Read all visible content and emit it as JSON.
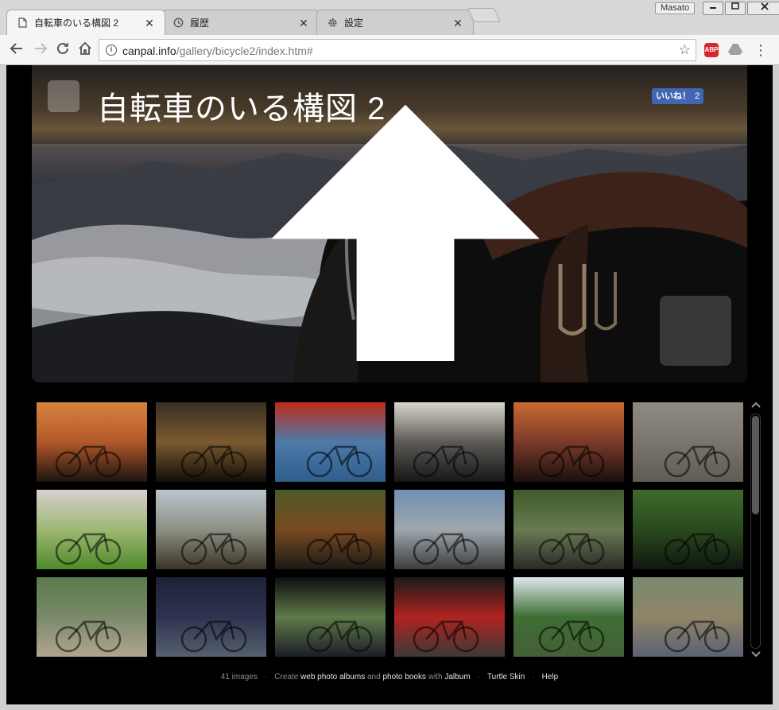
{
  "window": {
    "profile": "Masato",
    "tabs": [
      {
        "label": "自転車のいる構図 2",
        "icon": "page-icon",
        "active": true
      },
      {
        "label": "履歴",
        "icon": "history-icon",
        "active": false
      },
      {
        "label": "設定",
        "icon": "gear-icon",
        "active": false
      }
    ],
    "close_glyph": "✕"
  },
  "toolbar": {
    "url_host": "canpal.info",
    "url_path": "/gallery/bicycle2/index.htm#",
    "ext_label": "ABP"
  },
  "gallery": {
    "title": "自転車のいる構図 2",
    "like_label": "いいね！",
    "like_count": "2"
  },
  "thumbnails": [
    {
      "name": "sunset-sea-bikes",
      "top": "#d8833f",
      "mid": "#b2582a",
      "bottom": "#1a1410"
    },
    {
      "name": "golden-sea-bikes",
      "top": "#3a2e22",
      "mid": "#7a5a2f",
      "bottom": "#120e0a"
    },
    {
      "name": "handlebar-closeup",
      "top": "#c02a1a",
      "mid": "#4d7aa8",
      "bottom": "#2f5d8d"
    },
    {
      "name": "cloud-sea-handlebar",
      "top": "#d9d6cd",
      "mid": "#5d5a55",
      "bottom": "#16161a"
    },
    {
      "name": "sunset-handlebar",
      "top": "#c86a2f",
      "mid": "#7b3a2a",
      "bottom": "#1a100e"
    },
    {
      "name": "gravel-blue-bike",
      "top": "#8f8a82",
      "mid": "#7a766e",
      "bottom": "#5f5b55"
    },
    {
      "name": "sakura-meadow",
      "top": "#d8cfd0",
      "mid": "#9db872",
      "bottom": "#4f8a2a"
    },
    {
      "name": "post-figure",
      "top": "#b9c4cc",
      "mid": "#8e8f83",
      "bottom": "#3a3526"
    },
    {
      "name": "autumn-bike",
      "top": "#4c5a2a",
      "mid": "#7a4a22",
      "bottom": "#1a1a14"
    },
    {
      "name": "dome-building",
      "top": "#6f8fb4",
      "mid": "#9fa7ad",
      "bottom": "#3c3c3c"
    },
    {
      "name": "forest-road-bike",
      "top": "#3e5a2a",
      "mid": "#6a7a52",
      "bottom": "#2a2a28"
    },
    {
      "name": "red-flowers-bike",
      "top": "#3d6a2a",
      "mid": "#2a4a1e",
      "bottom": "#101810"
    },
    {
      "name": "shrine-path",
      "top": "#5a7a4a",
      "mid": "#7a8a6a",
      "bottom": "#b1a58e"
    },
    {
      "name": "night-street-bike",
      "top": "#1e2236",
      "mid": "#2e3450",
      "bottom": "#56606f"
    },
    {
      "name": "window-view",
      "top": "#0e0e10",
      "mid": "#5f7a4a",
      "bottom": "#1c1e26"
    },
    {
      "name": "station-train",
      "top": "#1a1a1a",
      "mid": "#b12320",
      "bottom": "#3c3a36"
    },
    {
      "name": "pond-temple",
      "top": "#dfe6ec",
      "mid": "#3e6e34",
      "bottom": "#445f38"
    },
    {
      "name": "riverbank-bike",
      "top": "#7a8a6e",
      "mid": "#8f8468",
      "bottom": "#5a6272"
    }
  ],
  "footer": {
    "count": "41 images",
    "create": "Create",
    "web_albums": "web photo albums",
    "and": "and",
    "photo_books": "photo books",
    "with": "with",
    "jalbum": "Jalbum",
    "skin": "Turtle Skin",
    "help": "Help",
    "sep": "·"
  }
}
